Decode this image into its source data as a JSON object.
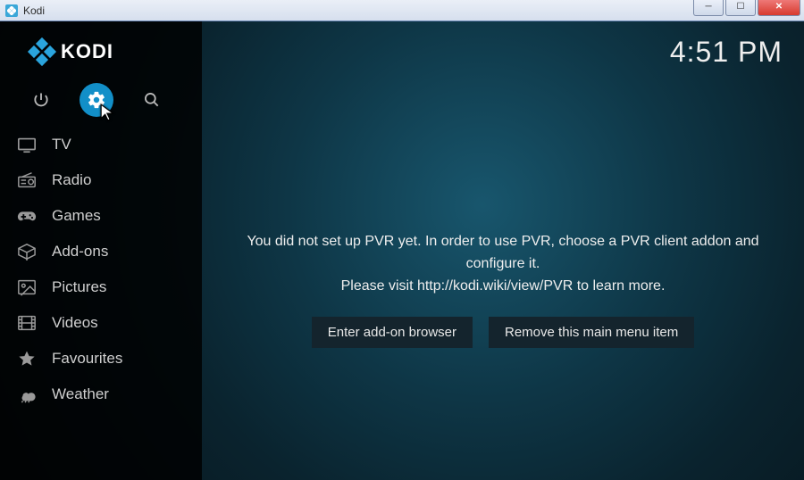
{
  "window": {
    "title": "Kodi"
  },
  "header": {
    "app_name": "KODI",
    "clock": "4:51 PM"
  },
  "sidebar": {
    "items": [
      {
        "label": "TV",
        "icon": "tv-icon"
      },
      {
        "label": "Radio",
        "icon": "radio-icon"
      },
      {
        "label": "Games",
        "icon": "gamepad-icon"
      },
      {
        "label": "Add-ons",
        "icon": "box-icon"
      },
      {
        "label": "Pictures",
        "icon": "picture-icon"
      },
      {
        "label": "Videos",
        "icon": "film-icon"
      },
      {
        "label": "Favourites",
        "icon": "star-icon"
      },
      {
        "label": "Weather",
        "icon": "weather-icon"
      }
    ]
  },
  "main": {
    "message_line1": "You did not set up PVR yet. In order to use PVR, choose a PVR client addon and configure it.",
    "message_line2": "Please visit http://kodi.wiki/view/PVR to learn more.",
    "button_browser": "Enter add-on browser",
    "button_remove": "Remove this main menu item"
  }
}
